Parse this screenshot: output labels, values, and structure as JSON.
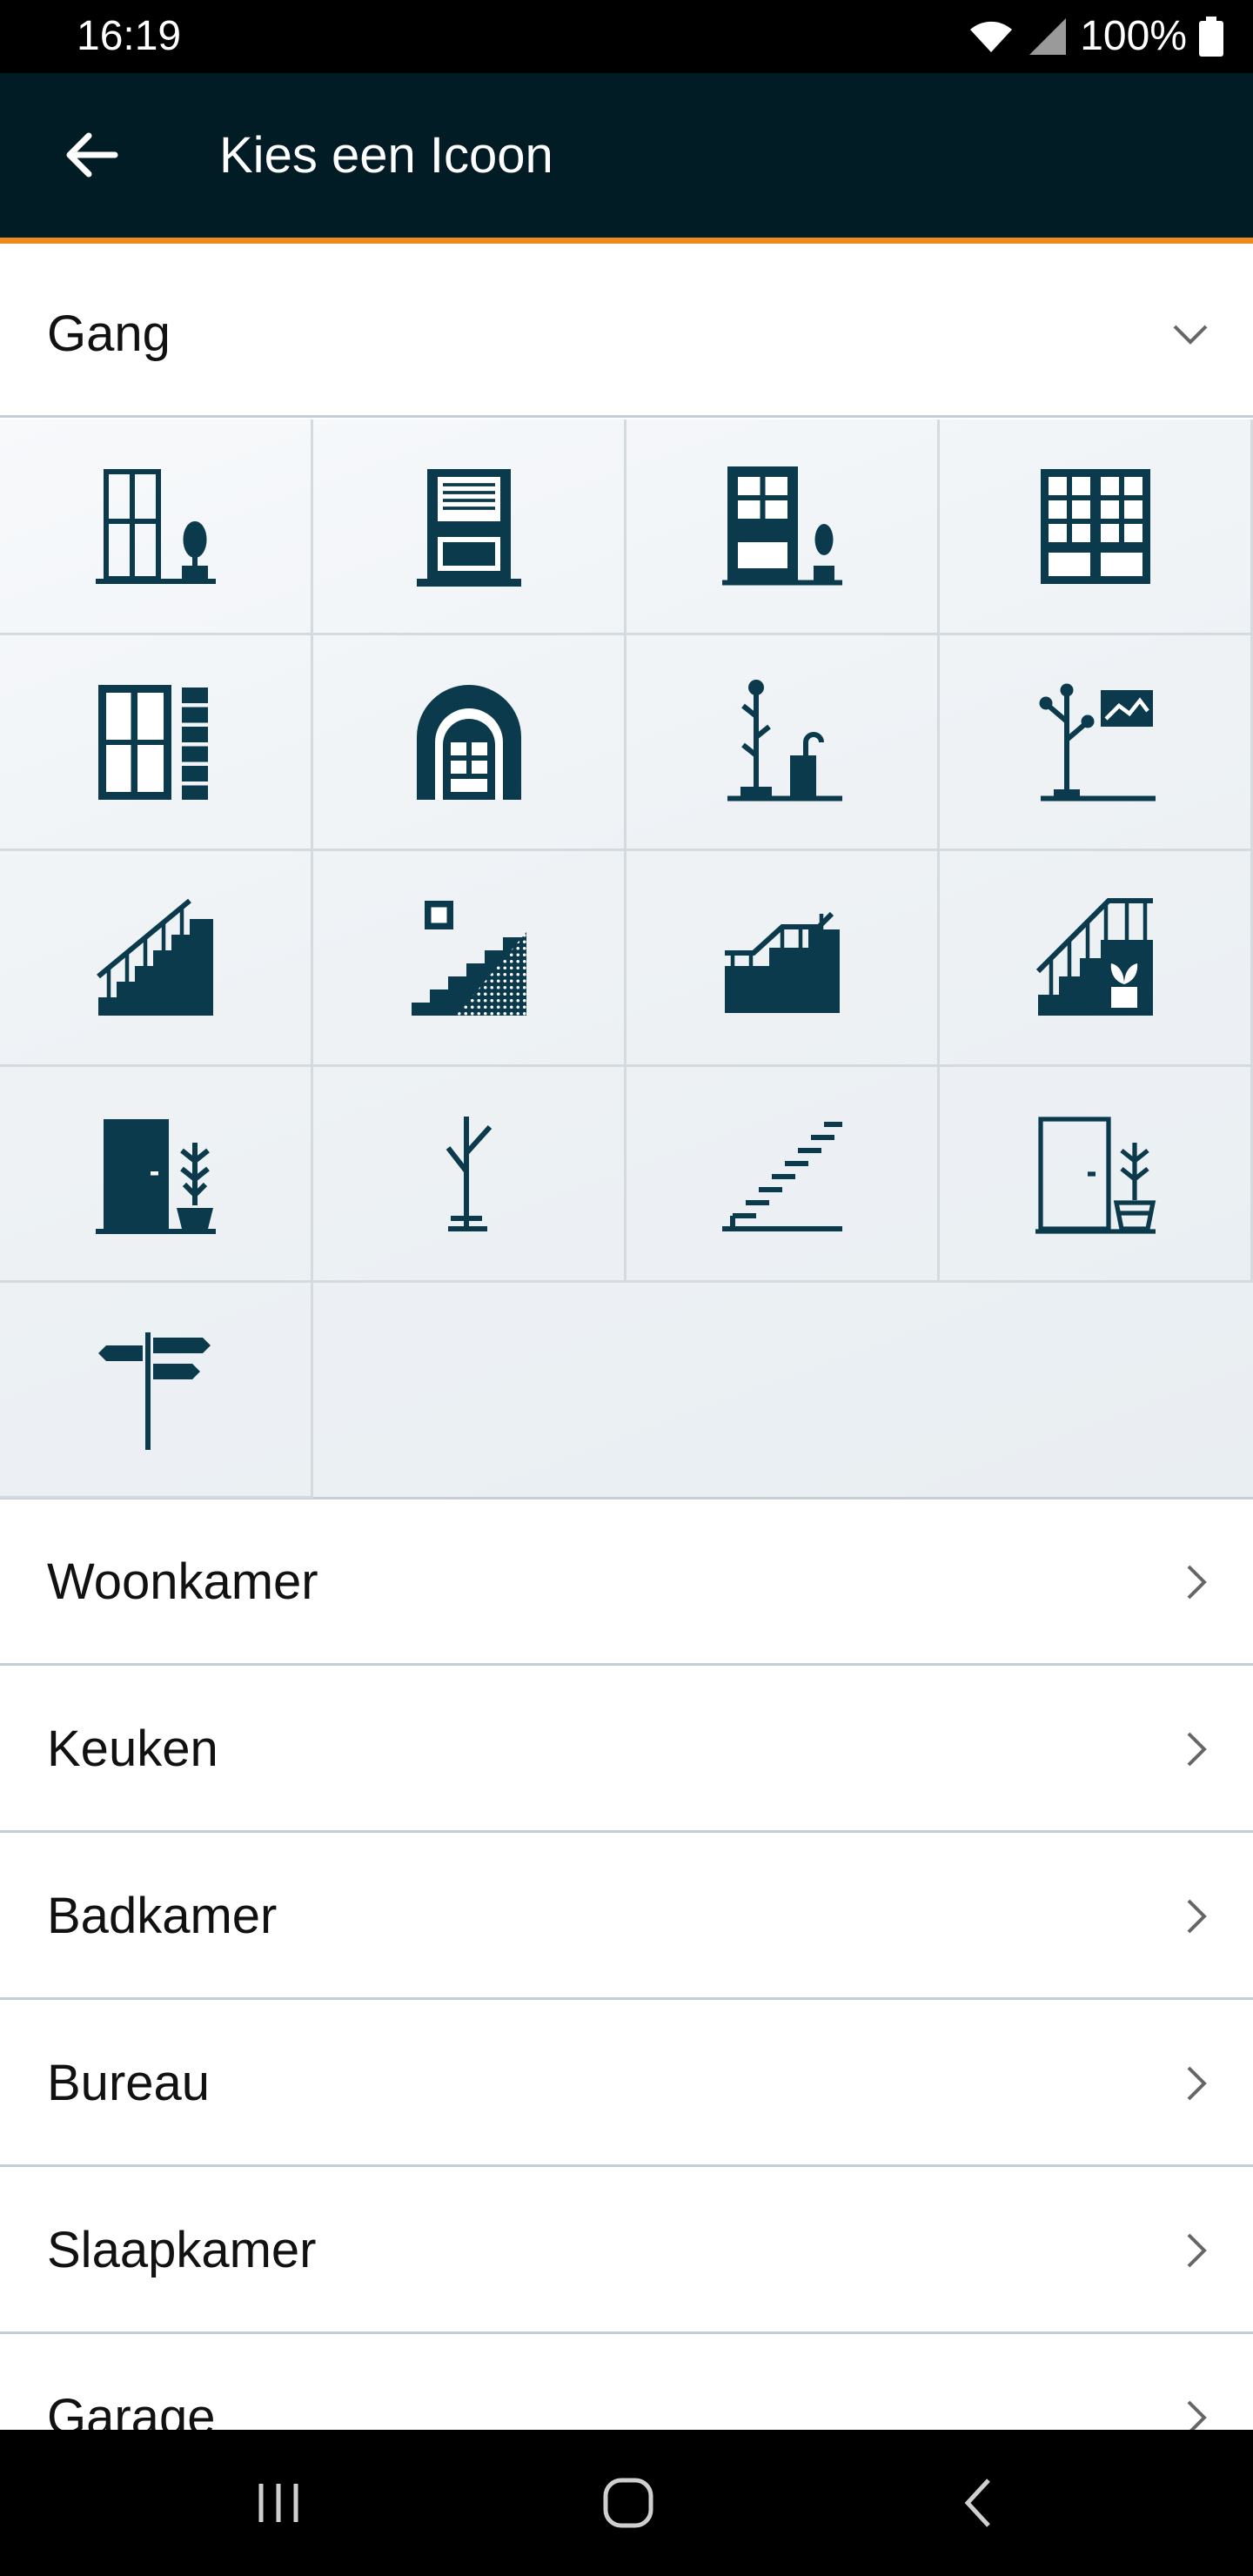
{
  "status_bar": {
    "time": "16:19",
    "battery": "100%"
  },
  "app_bar": {
    "title": "Kies een Icoon"
  },
  "expanded_section": {
    "label": "Gang",
    "icons": [
      "door-with-plant-icon",
      "door-with-blind-icon",
      "paneled-door-with-plant-icon",
      "double-door-icon",
      "door-with-glass-blocks-icon",
      "arched-door-icon",
      "coat-rack-with-umbrella-icon",
      "coat-rack-with-painting-icon",
      "staircase-with-railing-icon",
      "staircase-with-picture-icon",
      "staircase-icon",
      "staircase-with-plant-icon",
      "dark-door-with-plant-icon",
      "coat-stand-icon",
      "floating-stairs-icon",
      "outline-door-with-plant-icon",
      "signpost-icon"
    ]
  },
  "sections": [
    {
      "label": "Woonkamer"
    },
    {
      "label": "Keuken"
    },
    {
      "label": "Badkamer"
    },
    {
      "label": "Bureau"
    },
    {
      "label": "Slaapkamer"
    },
    {
      "label": "Garage"
    }
  ],
  "colors": {
    "app_bar": "#021c26",
    "accent": "#f08a1c",
    "icon": "#0b3a4c"
  }
}
